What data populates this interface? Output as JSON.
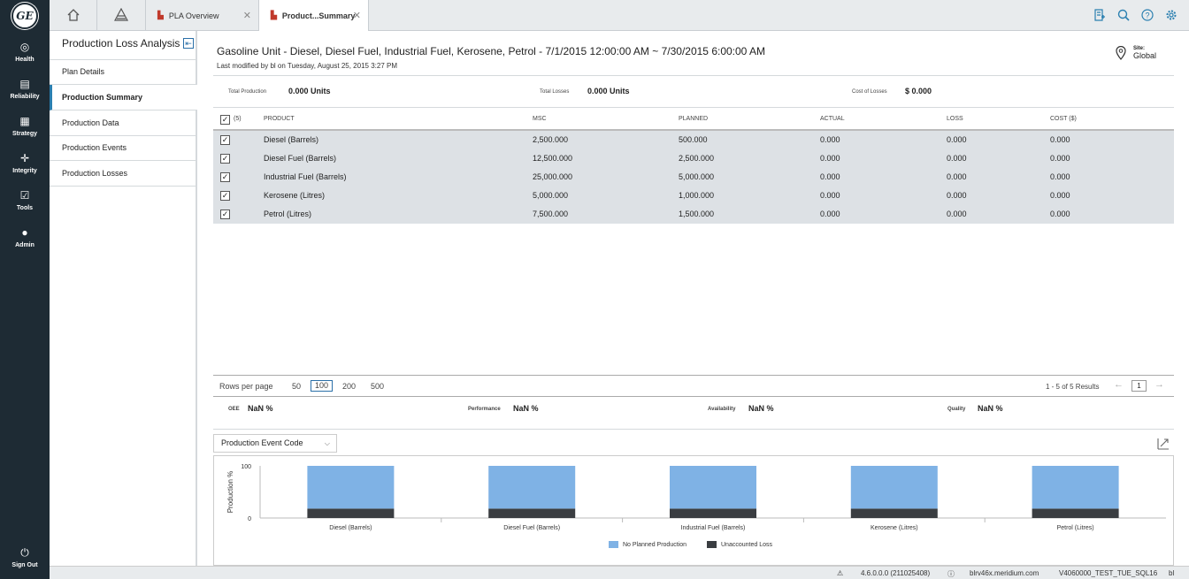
{
  "app": {
    "logo": "GE"
  },
  "nav": {
    "items": [
      {
        "label": "Health",
        "icon": "health-icon"
      },
      {
        "label": "Reliability",
        "icon": "reliability-icon"
      },
      {
        "label": "Strategy",
        "icon": "strategy-icon"
      },
      {
        "label": "Integrity",
        "icon": "integrity-icon"
      },
      {
        "label": "Tools",
        "icon": "tools-icon"
      },
      {
        "label": "Admin",
        "icon": "admin-icon"
      }
    ],
    "signout": "Sign Out"
  },
  "tabs": [
    {
      "label": "PLA Overview",
      "close": "✕"
    },
    {
      "label": "Product...Summary",
      "close": "✕"
    }
  ],
  "sidepanel": {
    "title": "Production Loss Analysis",
    "items": [
      "Plan Details",
      "Production Summary",
      "Production Data",
      "Production Events",
      "Production Losses"
    ]
  },
  "header": {
    "title": "Gasoline Unit - Diesel, Diesel Fuel, Industrial Fuel, Kerosene, Petrol - 7/1/2015 12:00:00 AM ~ 7/30/2015 6:00:00 AM",
    "subtitle": "Last modified by bl on Tuesday, August 25, 2015 3:27 PM",
    "site_label": "Site:",
    "site_value": "Global"
  },
  "totals": {
    "production_label": "Total Production",
    "production_value": "0.000 Units",
    "losses_label": "Total Losses",
    "losses_value": "0.000 Units",
    "cost_label": "Cost of Losses",
    "cost_value": "$ 0.000"
  },
  "grid": {
    "selected_count": "(5)",
    "columns": [
      "PRODUCT",
      "MSC",
      "PLANNED",
      "ACTUAL",
      "LOSS",
      "COST ($)"
    ],
    "rows": [
      [
        "Diesel (Barrels)",
        "2,500.000",
        "500.000",
        "0.000",
        "0.000",
        "0.000"
      ],
      [
        "Diesel Fuel (Barrels)",
        "12,500.000",
        "2,500.000",
        "0.000",
        "0.000",
        "0.000"
      ],
      [
        "Industrial Fuel (Barrels)",
        "25,000.000",
        "5,000.000",
        "0.000",
        "0.000",
        "0.000"
      ],
      [
        "Kerosene (Litres)",
        "5,000.000",
        "1,000.000",
        "0.000",
        "0.000",
        "0.000"
      ],
      [
        "Petrol (Litres)",
        "7,500.000",
        "1,500.000",
        "0.000",
        "0.000",
        "0.000"
      ]
    ]
  },
  "pager": {
    "label": "Rows per page",
    "options": [
      "50",
      "100",
      "200",
      "500"
    ],
    "selected": "100",
    "results": "1 - 5 of 5 Results",
    "page": "1"
  },
  "kpis": [
    {
      "label": "OEE",
      "value": "NaN %"
    },
    {
      "label": "Performance",
      "value": "NaN %"
    },
    {
      "label": "Availability",
      "value": "NaN %"
    },
    {
      "label": "Quality",
      "value": "NaN %"
    }
  ],
  "chart_select": "Production Event Code",
  "chart_data": {
    "type": "bar",
    "stacked": true,
    "categories": [
      "Diesel (Barrels)",
      "Diesel Fuel (Barrels)",
      "Industrial Fuel (Barrels)",
      "Kerosene (Litres)",
      "Petrol (Litres)"
    ],
    "series": [
      {
        "name": "Unaccounted Loss",
        "color": "#3a3d41",
        "values": [
          18,
          18,
          18,
          18,
          18
        ]
      },
      {
        "name": "No Planned Production",
        "color": "#7fb2e5",
        "values": [
          82,
          82,
          82,
          82,
          82
        ]
      }
    ],
    "ylabel": "Production %",
    "yticks": [
      "0",
      "100"
    ],
    "ylim": [
      0,
      100
    ]
  },
  "status": {
    "version": "4.6.0.0.0 (211025408)",
    "server": "blrv46x.meridium.com",
    "db": "V4060000_TEST_TUE_SQL16",
    "user": "bl"
  }
}
